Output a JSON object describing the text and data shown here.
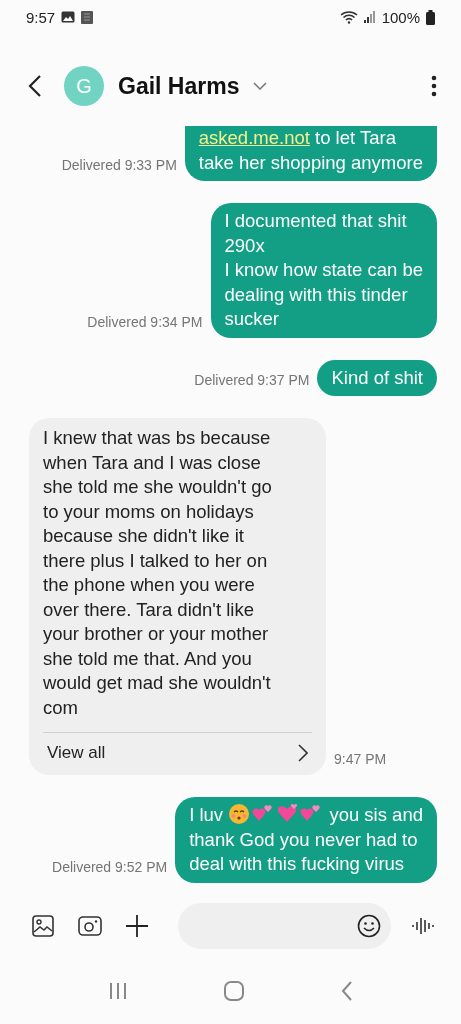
{
  "status_bar": {
    "time": "9:57",
    "battery": "100%"
  },
  "header": {
    "contact_name": "Gail Harms",
    "avatar_letter": "G"
  },
  "messages": [
    {
      "kind": "sent",
      "parts": [
        {
          "kind": "link",
          "text": "asked.me.not"
        },
        {
          "kind": "text",
          "text": " to let Tara\ntake her shopping anymore"
        }
      ],
      "status": "Delivered 9:33 PM"
    },
    {
      "kind": "sent",
      "parts": [
        {
          "kind": "text",
          "text": "I documented that shit\n290x\n I know how state can be\ndealing with this tinder\nsucker"
        }
      ],
      "status": "Delivered 9:34 PM"
    },
    {
      "kind": "sent",
      "parts": [
        {
          "kind": "text",
          "text": "Kind of shit"
        }
      ],
      "status": "Delivered 9:37 PM"
    },
    {
      "kind": "received",
      "parts": [
        {
          "kind": "text",
          "text": "I knew that was bs because\nwhen Tara and I was close\nshe told me she wouldn't go\nto your moms on holidays\nbecause she didn't like it\nthere plus I talked to her on\nthe phone when you were\nover there. Tara didn't like\nyour brother or your mother\nshe told me that. And you\nwould get mad she wouldn't\ncom"
        }
      ],
      "view_all": "View all",
      "status": "9:47 PM"
    },
    {
      "kind": "sent",
      "parts": [
        {
          "kind": "text",
          "text": "I luv "
        },
        {
          "kind": "kiss"
        },
        {
          "kind": "hearts"
        },
        {
          "kind": "heart"
        },
        {
          "kind": "hearts"
        },
        {
          "kind": "text",
          "text": " you sis and\nthank God you never had to\ndeal with this fucking virus"
        }
      ],
      "status": "Delivered 9:52 PM"
    }
  ]
}
